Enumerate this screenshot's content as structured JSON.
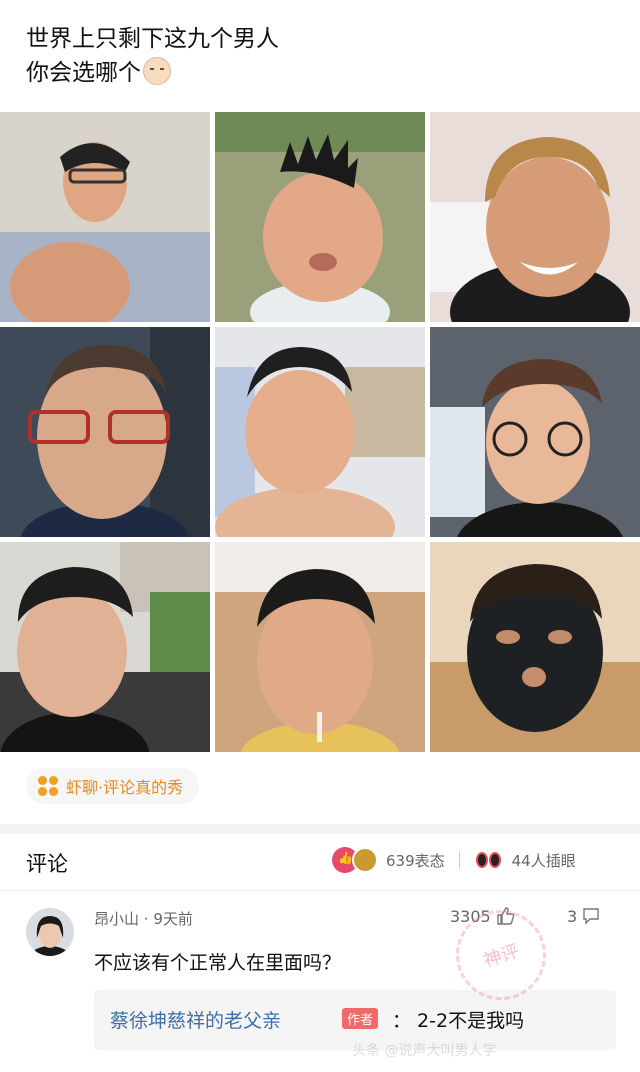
{
  "post": {
    "title_line1": "世界上只剩下这九个男人",
    "title_line2": "你会选哪个",
    "emoji_icon": "smirk-face-emoji"
  },
  "topic_tag": {
    "label": "虾聊·评论真的秀",
    "color": "#e58a1e"
  },
  "comments_header": {
    "title": "评论",
    "reactions_count": "639表态",
    "interject_count": "44人插眼"
  },
  "comment": {
    "user": "昂小山",
    "time": "· 9天前",
    "likes": "3305",
    "replies": "3",
    "text": "不应该有个正常人在里面吗？",
    "reply": {
      "author": "蔡徐坤慈祥的老父亲",
      "badge": "作者",
      "text": "：  2-2不是我吗"
    },
    "stamp": "神评"
  },
  "watermark": "头条 @说声大叫男人学",
  "colors": {
    "accent_pink": "#e8486a",
    "link_blue": "#3d6fa8",
    "author_badge": "#f06a6a"
  }
}
